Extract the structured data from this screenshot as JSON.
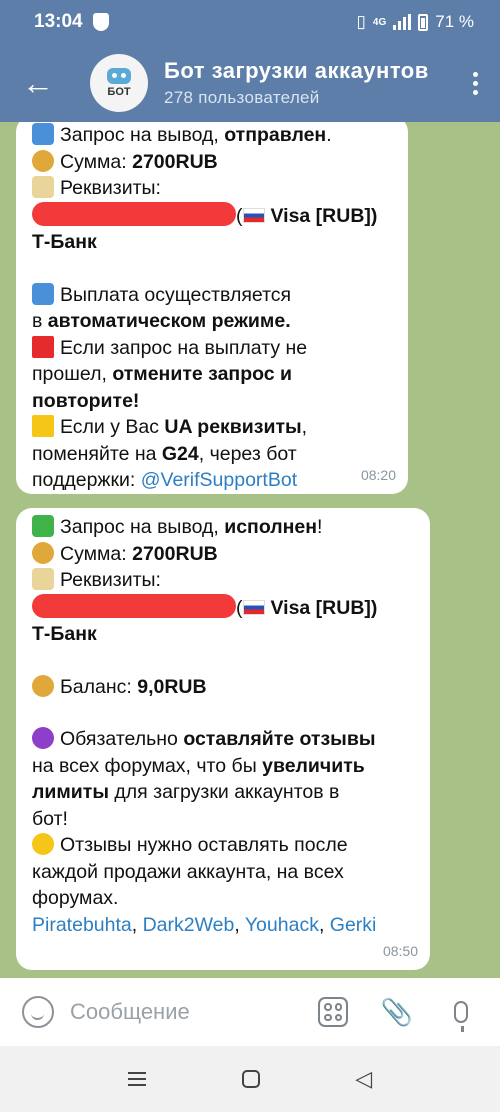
{
  "status": {
    "time": "13:04",
    "network": "4G",
    "battery": "71 %"
  },
  "header": {
    "title": "Бот загрузки аккаунтов",
    "subtitle": "278 пользователей",
    "avatar_text": "БОТ"
  },
  "messages": [
    {
      "line1_pre": "Запрос на вывод, ",
      "line1_bold": "отправлен",
      "line1_post": ".",
      "sum_label": "Сумма: ",
      "sum_value": "2700RUB",
      "req_label": "Реквизиты:",
      "card_type": "Visa [RUB])",
      "bank": "Т-Банк",
      "info_pre": "Выплата осуществляется",
      "info_line2_pre": "в ",
      "info_bold": "автоматическом режиме.",
      "red_pre": "Если запрос на выплату не",
      "red_line2_pre": "прошел, ",
      "red_bold": "отмените запрос и",
      "red_bold2": "повторите!",
      "yellow_pre": "Если у Вас ",
      "yellow_bold": "UA реквизиты",
      "yellow_post": ",",
      "yellow_line2_pre": "поменяйте на ",
      "yellow_bold2": "G24",
      "yellow_line2_post": ", через бот",
      "yellow_line3": "поддержки: ",
      "support_link": "@VerifSupportBot",
      "time": "08:20"
    },
    {
      "line1_pre": "Запрос на вывод, ",
      "line1_bold": "исполнен",
      "line1_post": "!",
      "sum_label": "Сумма: ",
      "sum_value": "2700RUB",
      "req_label": "Реквизиты:",
      "card_type": "Visa [RUB])",
      "bank": "Т-Банк",
      "balance_label": "Баланс: ",
      "balance_value": "9,0RUB",
      "purple_pre": "Обязательно ",
      "purple_bold": "оставляйте отзывы",
      "purple_line2_pre": "на всех форумах, что бы ",
      "purple_bold2": "увеличить",
      "purple_line3_bold": "лимиты",
      "purple_line3_post": " для загрузки аккаунтов в",
      "purple_line4": "бот!",
      "yellow_line1": "Отзывы нужно оставлять после",
      "yellow_line2": "каждой продажи аккаунта, на всех",
      "yellow_line3": "форумах.",
      "links": [
        "Piratebuhta",
        "Dark2Web",
        "Youhack",
        "Gerki"
      ],
      "time": "08:50"
    }
  ],
  "input": {
    "placeholder": "Сообщение"
  }
}
